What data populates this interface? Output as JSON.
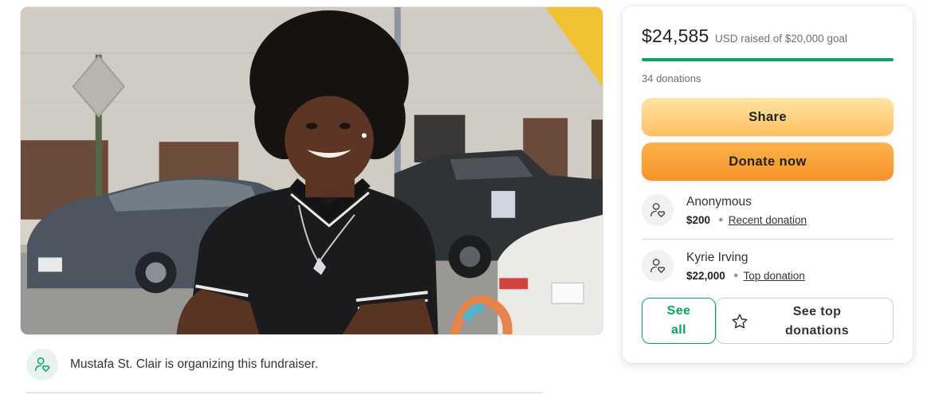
{
  "organizer": {
    "text": "Mustafa St. Clair is organizing this fundraiser."
  },
  "fundraiser": {
    "amount_raised": "$24,585",
    "goal_text": "USD raised of $20,000 goal",
    "progress_percent": 100,
    "donations_count": "34 donations",
    "accent_color": "#02a95c"
  },
  "actions": {
    "share_label": "Share",
    "donate_label": "Donate now",
    "see_all_label": "See all",
    "see_top_label": "See top donations"
  },
  "donors": [
    {
      "name": "Anonymous",
      "amount": "$200",
      "type": "Recent donation",
      "icon": "donor-heart-icon"
    },
    {
      "name": "Kyrie Irving",
      "amount": "$22,000",
      "type": "Top donation",
      "icon": "donor-heart-icon"
    }
  ],
  "icons": {
    "organizer": "organizer-heart-icon",
    "see_top": "star-icon"
  }
}
